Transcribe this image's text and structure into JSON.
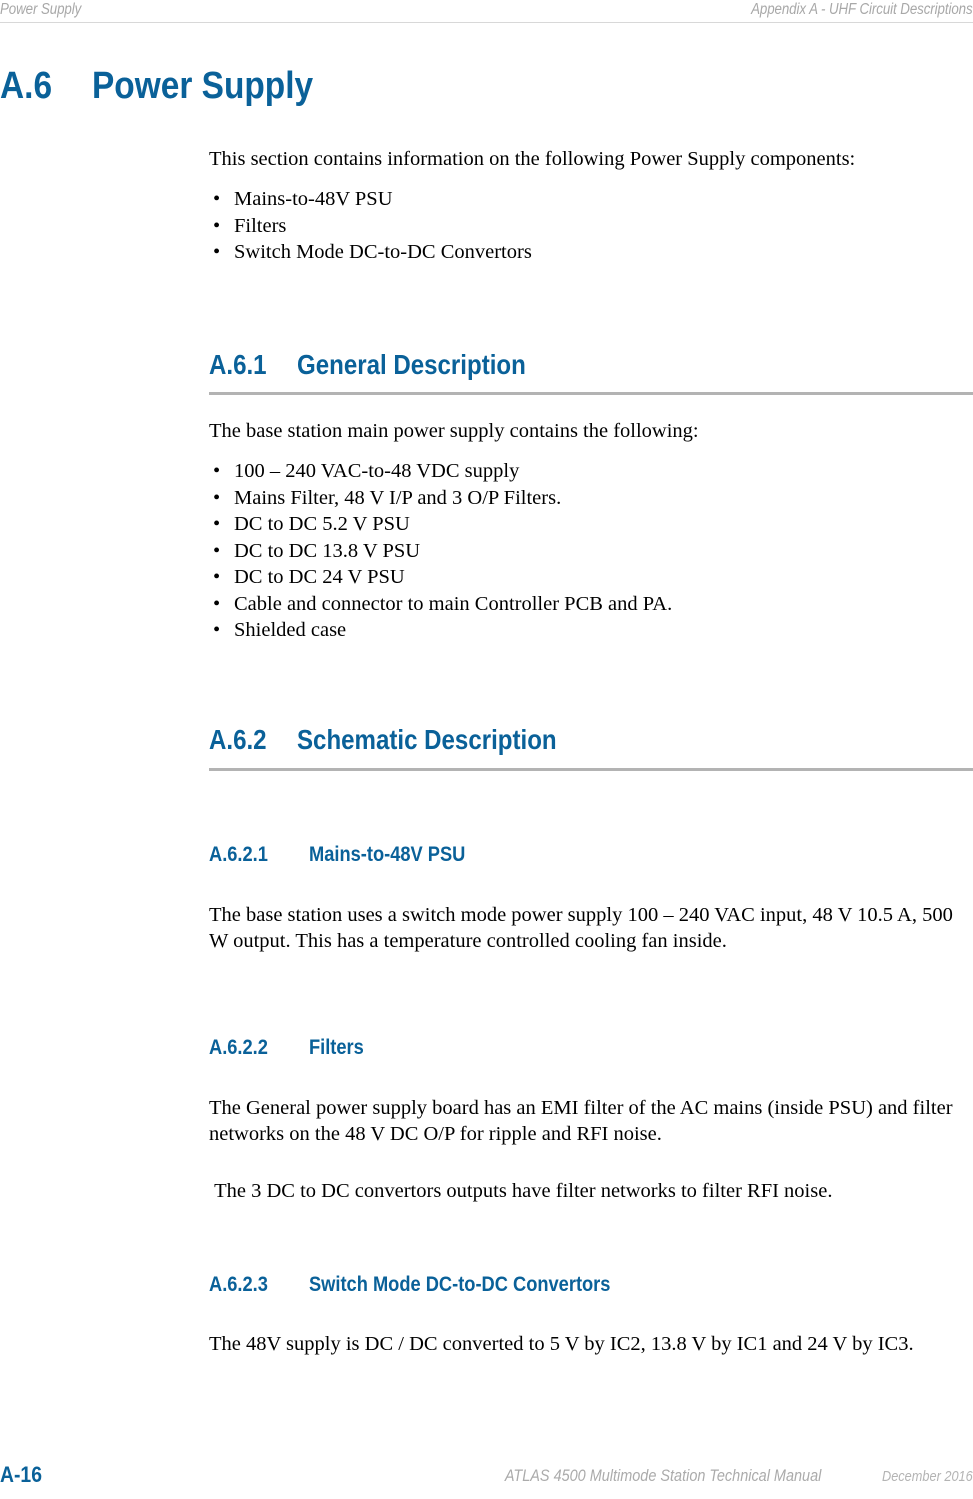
{
  "header": {
    "left": "Power Supply",
    "right": "Appendix A - UHF Circuit Descriptions"
  },
  "accent_color": "#0a6199",
  "rule_color": "#b3b3b3",
  "section": {
    "number": "A.6",
    "title": "Power Supply",
    "intro": "This section contains information on the following Power Supply components:",
    "intro_bullets": [
      "Mains-to-48V PSU",
      "Filters",
      "Switch Mode DC-to-DC Convertors"
    ]
  },
  "general_description": {
    "number": "A.6.1",
    "title": "General Description",
    "intro": "The base station main power supply contains the following:",
    "bullets": [
      "100 – 240 VAC-to-48 VDC supply",
      "Mains Filter, 48 V I/P and 3 O/P Filters.",
      "DC to DC 5.2 V PSU",
      "DC to DC 13.8 V PSU",
      "DC to DC 24 V PSU",
      "Cable and connector to main Controller PCB and PA.",
      "Shielded case"
    ]
  },
  "schematic_description": {
    "number": "A.6.2",
    "title": "Schematic Description"
  },
  "mains_psu": {
    "number": "A.6.2.1",
    "title": "Mains-to-48V PSU",
    "body": "The base station uses a switch mode power supply 100 – 240 VAC input, 48 V 10.5 A, 500 W output. This has a temperature controlled cooling fan inside."
  },
  "filters": {
    "number": "A.6.2.2",
    "title": "Filters",
    "body_1": "The General power supply board has an EMI filter of the AC mains (inside PSU) and filter networks on the 48 V DC O/P for ripple and RFI noise.",
    "body_2": " The 3 DC to DC convertors outputs have filter networks to filter RFI noise."
  },
  "dcdc": {
    "number": "A.6.2.3",
    "title": "Switch Mode DC-to-DC Convertors",
    "body": "The 48V supply is DC / DC converted to 5 V by IC2, 13.8 V by IC1 and 24 V by IC3."
  },
  "bullet_glyph": "•",
  "footer": {
    "page_number": "A-16",
    "manual_title": "ATLAS 4500 Multimode Station Technical Manual",
    "date": "December 2016"
  }
}
